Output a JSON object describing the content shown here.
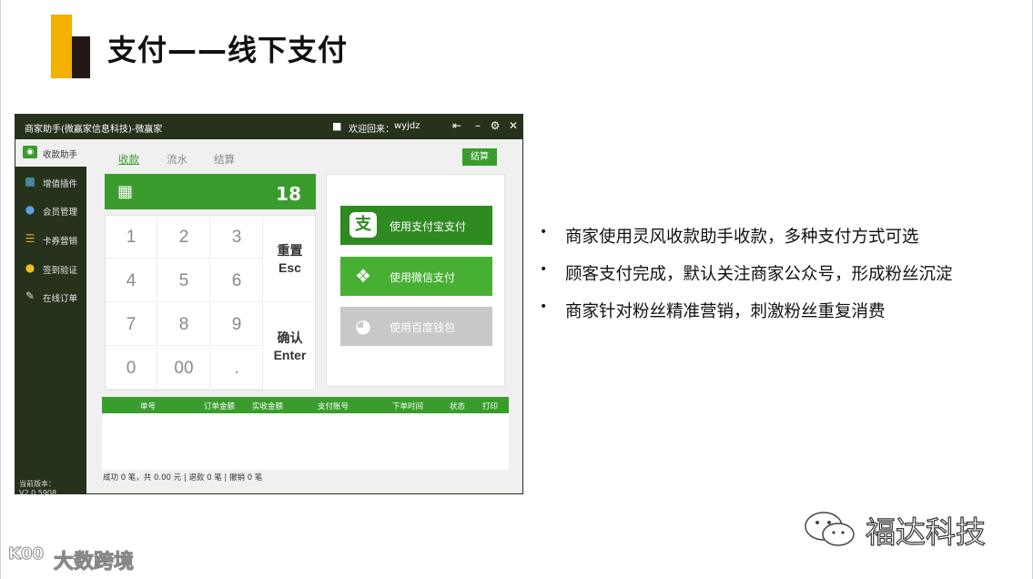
{
  "slide": {
    "title": "支付——线下支付"
  },
  "window": {
    "title": "商家助手(微赢家信息科技)-微赢家",
    "welcome": "欢迎回来：",
    "username": "wyjdz",
    "icons": [
      "user-icon",
      "pin-icon",
      "minimize-icon",
      "settings-icon",
      "close-icon"
    ]
  },
  "sidebar": {
    "items": [
      {
        "label": "收款助手",
        "icon": "cash-register-icon",
        "active": true
      },
      {
        "label": "增值插件",
        "icon": "puzzle-icon",
        "active": false
      },
      {
        "label": "会员管理",
        "icon": "members-icon",
        "active": false
      },
      {
        "label": "卡券营销",
        "icon": "coupon-icon",
        "active": false
      },
      {
        "label": "签到验证",
        "icon": "checkin-icon",
        "active": false
      },
      {
        "label": "在线订单",
        "icon": "order-icon",
        "active": false
      }
    ],
    "version": "当前版本：V2.0.5908"
  },
  "tabs": [
    {
      "label": "收款",
      "active": true
    },
    {
      "label": "流水",
      "active": false
    },
    {
      "label": "结算",
      "active": false
    }
  ],
  "settle_button": "结算",
  "amount": {
    "icon": "calculator-icon",
    "value": "18"
  },
  "keypad": {
    "keys": [
      "1",
      "2",
      "3",
      "4",
      "5",
      "6",
      "7",
      "8",
      "9",
      "0",
      "00",
      "."
    ],
    "reset_label": "重置",
    "reset_key": "Esc",
    "confirm_label": "确认",
    "confirm_key": "Enter"
  },
  "payment": {
    "alipay": {
      "label": "使用支付宝支付",
      "icon_char": "支",
      "icon": "alipay-icon"
    },
    "wechat": {
      "label": "使用微信支付",
      "icon": "wechat-icon"
    },
    "baidu": {
      "label": "使用百度钱包",
      "icon": "baidu-wallet-icon"
    }
  },
  "table": {
    "columns": [
      "单号",
      "订单金额",
      "实收金额",
      "支付账号",
      "下单时间",
      "状态",
      "打印"
    ]
  },
  "summary": "成功  0  笔，共  0.00  元  |  退款  0  笔  |  撤销  0  笔",
  "bullets": [
    "商家使用灵风收款助手收款，多种支付方式可选",
    "顾客支付完成，默认关注商家公众号，形成粉丝沉淀",
    "商家针对粉丝精准营销，刺激粉丝重复消费"
  ],
  "watermarks": {
    "right": "福达科技",
    "left_logo": "K00",
    "left": "大数跨境"
  },
  "colors": {
    "accent_yellow": "#f2b000",
    "dark": "#231815",
    "sidebar": "#26321c",
    "green": "#3a9c2d",
    "alipay_green": "#2f8a22",
    "wechat_green": "#47b033",
    "disabled_gray": "#c8c8c8"
  }
}
